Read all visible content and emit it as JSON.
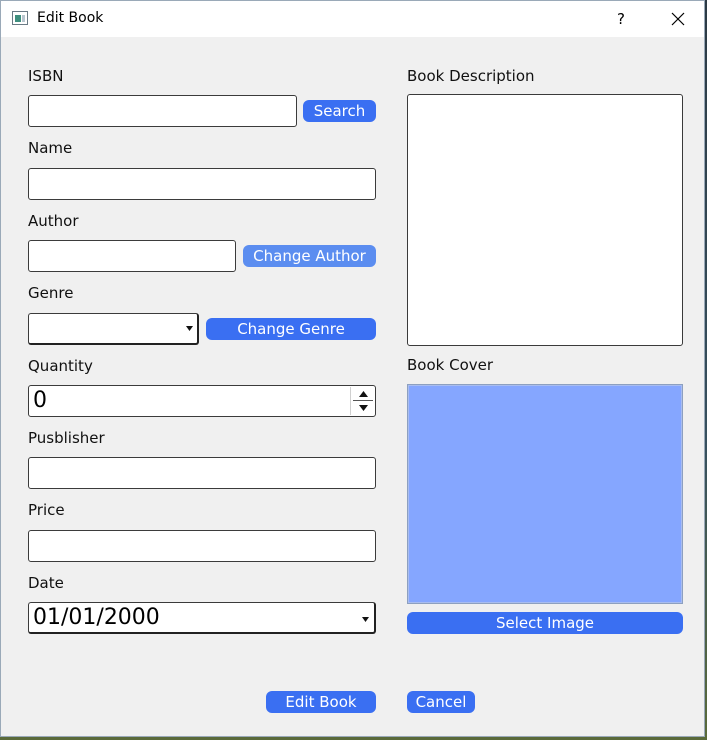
{
  "window": {
    "title": "Edit Book",
    "help_label": "?"
  },
  "form": {
    "isbn": {
      "label": "ISBN",
      "value": "",
      "search_label": "Search"
    },
    "name": {
      "label": "Name",
      "value": ""
    },
    "author": {
      "label": "Author",
      "value": "",
      "change_label": "Change Author"
    },
    "genre": {
      "label": "Genre",
      "selected": "",
      "change_label": "Change Genre"
    },
    "quantity": {
      "label": "Quantity",
      "value": "0"
    },
    "publisher": {
      "label": "Pusblisher",
      "value": ""
    },
    "price": {
      "label": "Price",
      "value": ""
    },
    "date": {
      "label": "Date",
      "value": "01/01/2000"
    },
    "description": {
      "label": "Book Description",
      "value": ""
    },
    "cover": {
      "label": "Book Cover",
      "select_label": "Select Image"
    }
  },
  "actions": {
    "edit_label": "Edit Book",
    "cancel_label": "Cancel"
  },
  "colors": {
    "accent": "#3a6ff2",
    "accent_light": "#5b8df0",
    "cover_fill": "#85a6ff"
  }
}
